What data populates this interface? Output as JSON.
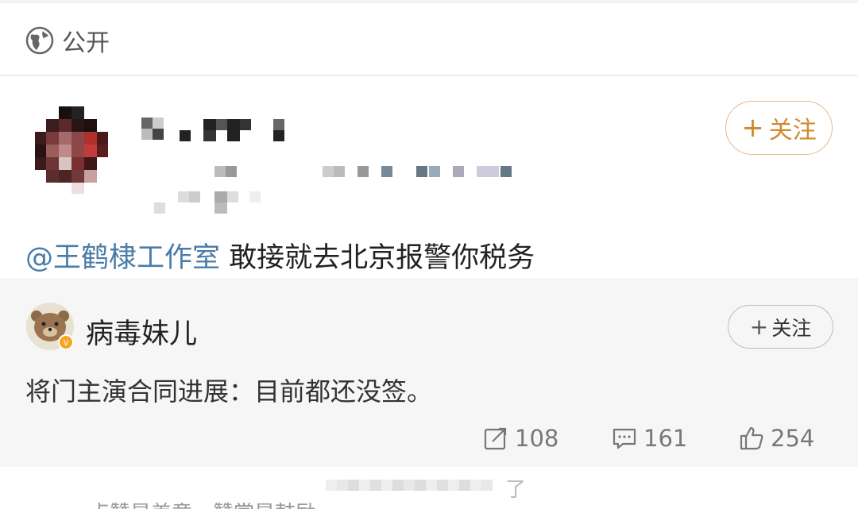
{
  "visibility": {
    "icon": "globe-icon",
    "label": "公开"
  },
  "post": {
    "follow_label": "关注",
    "mention": "@王鹤棣工作室",
    "text": " 敢接就去北京报警你税务"
  },
  "repost": {
    "author": "病毒妹儿",
    "verified_badge": "v",
    "follow_label": "关注",
    "text": "将门主演合同进展：目前都还没签。",
    "stats": {
      "reposts": "108",
      "comments": "161",
      "likes": "254"
    }
  },
  "footer": {
    "partial_text": "点赞是美意，赞赏是鼓励",
    "partial_suffix": "了"
  },
  "colors": {
    "accent_orange": "#d08a2a",
    "mention_blue": "#4a7ca8",
    "card_bg": "#f6f6f6"
  }
}
